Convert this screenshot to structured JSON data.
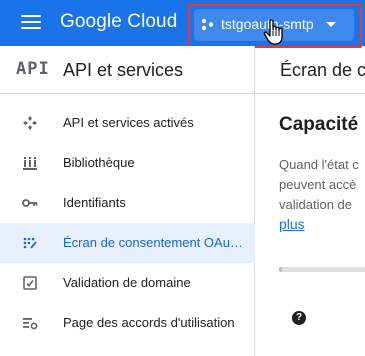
{
  "topbar": {
    "logo_text": "Google Cloud",
    "project_name": "tstgoauth-smtp",
    "hamburger_icon": "menu-icon",
    "project_icon": "project-dots-icon",
    "caret_icon": "caret-down-icon"
  },
  "sidebar": {
    "mark": "API",
    "title": "API et services",
    "items": [
      {
        "label": "API et services activés",
        "icon": "api-diamond-icon"
      },
      {
        "label": "Bibliothèque",
        "icon": "library-icon"
      },
      {
        "label": "Identifiants",
        "icon": "key-icon"
      },
      {
        "label": "Écran de consentement OAu…",
        "icon": "consent-icon",
        "active": true
      },
      {
        "label": "Validation de domaine",
        "icon": "checkbox-icon"
      },
      {
        "label": "Page des accords d'utilisation",
        "icon": "agreements-icon"
      }
    ]
  },
  "main": {
    "title": "Écran de co",
    "section_title": "Capacité",
    "paragraph_lines": [
      "Quand l'état c",
      "peuvent accè",
      "validation de"
    ],
    "more_link": "plus",
    "help_glyph": "?"
  },
  "colors": {
    "brand_blue": "#1a73e8",
    "highlight_red": "#e53935",
    "active_bg": "#e8f0fe",
    "active_text": "#1967d2"
  }
}
